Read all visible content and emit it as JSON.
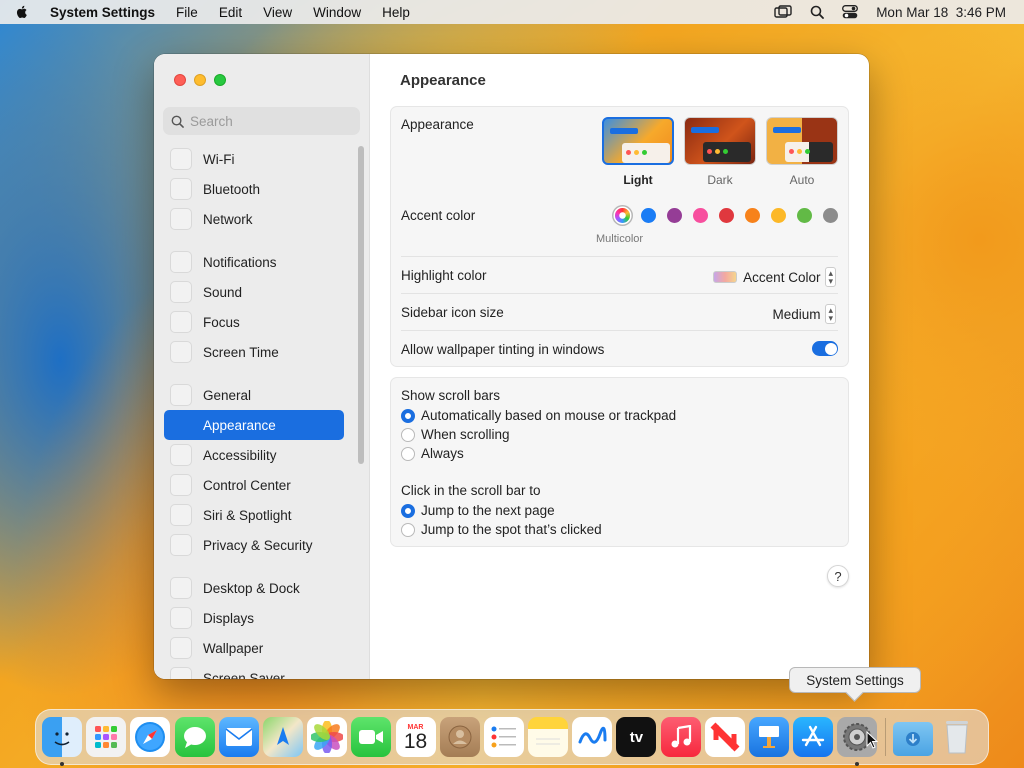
{
  "menubar": {
    "app_name": "System Settings",
    "menus": [
      "File",
      "Edit",
      "View",
      "Window",
      "Help"
    ],
    "clock": "Mon Mar 18  3:46 PM"
  },
  "sidebar": {
    "search_placeholder": "Search",
    "items": [
      {
        "label": "Wi-Fi",
        "name": "wifi"
      },
      {
        "label": "Bluetooth",
        "name": "bluetooth"
      },
      {
        "label": "Network",
        "name": "network"
      },
      {
        "label": "Notifications",
        "name": "notifications"
      },
      {
        "label": "Sound",
        "name": "sound"
      },
      {
        "label": "Focus",
        "name": "focus"
      },
      {
        "label": "Screen Time",
        "name": "screen-time"
      },
      {
        "label": "General",
        "name": "general"
      },
      {
        "label": "Appearance",
        "name": "appearance",
        "active": true
      },
      {
        "label": "Accessibility",
        "name": "accessibility"
      },
      {
        "label": "Control Center",
        "name": "control-center"
      },
      {
        "label": "Siri & Spotlight",
        "name": "siri-spotlight"
      },
      {
        "label": "Privacy & Security",
        "name": "privacy-security"
      },
      {
        "label": "Desktop & Dock",
        "name": "desktop-dock"
      },
      {
        "label": "Displays",
        "name": "displays"
      },
      {
        "label": "Wallpaper",
        "name": "wallpaper"
      },
      {
        "label": "Screen Saver",
        "name": "screen-saver"
      }
    ]
  },
  "content": {
    "title": "Appearance",
    "appearance": {
      "label": "Appearance",
      "options": [
        {
          "label": "Light",
          "selected": true
        },
        {
          "label": "Dark",
          "selected": false
        },
        {
          "label": "Auto",
          "selected": false
        }
      ]
    },
    "accent": {
      "label": "Accent color",
      "colors": [
        "multicolor",
        "#1a7cf5",
        "#953d96",
        "#f74f9e",
        "#e0383e",
        "#f7821b",
        "#fcb827",
        "#62ba46",
        "#8c8c8c"
      ],
      "selected_caption": "Multicolor"
    },
    "highlight": {
      "label": "Highlight color",
      "value": "Accent Color"
    },
    "icon_size": {
      "label": "Sidebar icon size",
      "value": "Medium"
    },
    "tinting": {
      "label": "Allow wallpaper tinting in windows",
      "enabled": true
    },
    "scroll_bars": {
      "label": "Show scroll bars",
      "options": [
        {
          "label": "Automatically based on mouse or trackpad",
          "selected": true
        },
        {
          "label": "When scrolling",
          "selected": false
        },
        {
          "label": "Always",
          "selected": false
        }
      ]
    },
    "click_scroll": {
      "label": "Click in the scroll bar to",
      "options": [
        {
          "label": "Jump to the next page",
          "selected": true
        },
        {
          "label": "Jump to the spot that’s clicked",
          "selected": false
        }
      ]
    },
    "help": "?"
  },
  "tooltip": "System Settings",
  "dock": {
    "calendar_month": "MAR",
    "calendar_day": "18",
    "tv_label": "tv"
  },
  "colors": {
    "accent": "#1a6ee0",
    "window_bg": "#ffffff",
    "sidebar_bg": "#ececec"
  }
}
